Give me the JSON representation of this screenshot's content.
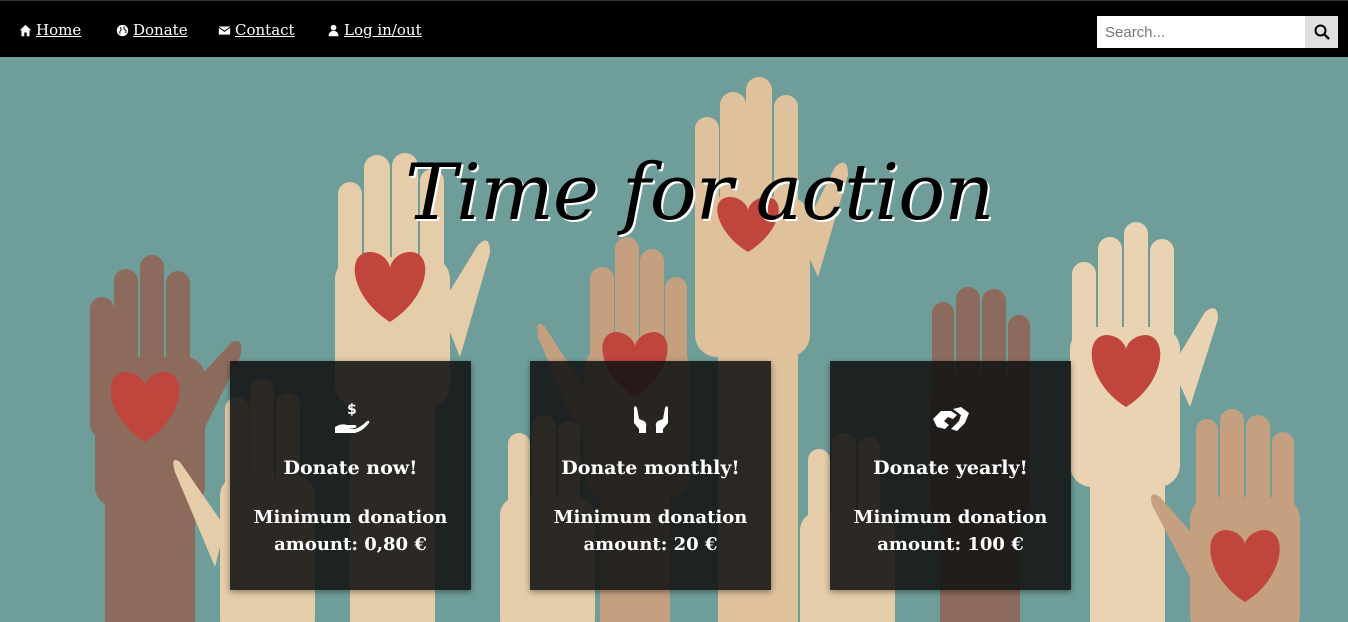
{
  "nav": {
    "items": [
      {
        "label": " Home",
        "icon": "home-icon"
      },
      {
        "label": " Donate",
        "icon": "globe-icon"
      },
      {
        "label": " Contact",
        "icon": "envelope-icon"
      },
      {
        "label": " Log in/out",
        "icon": "user-icon"
      }
    ],
    "search": {
      "placeholder": "Search...",
      "value": "",
      "button_icon": "search-icon"
    }
  },
  "hero": {
    "title": "Time for action"
  },
  "cards": [
    {
      "icon": "hand-holding-dollar-icon",
      "title": "Donate now!",
      "desc": "Minimum donation amount: 0,80 €"
    },
    {
      "icon": "hands-holding-icon",
      "title": "Donate monthly!",
      "desc": "Minimum donation amount: 20 €"
    },
    {
      "icon": "handshake-icon",
      "title": "Donate yearly!",
      "desc": "Minimum donation amount: 100 €"
    }
  ],
  "colors": {
    "background": "#6f9e9a",
    "nav": "#000000",
    "heart": "#c0453d"
  }
}
